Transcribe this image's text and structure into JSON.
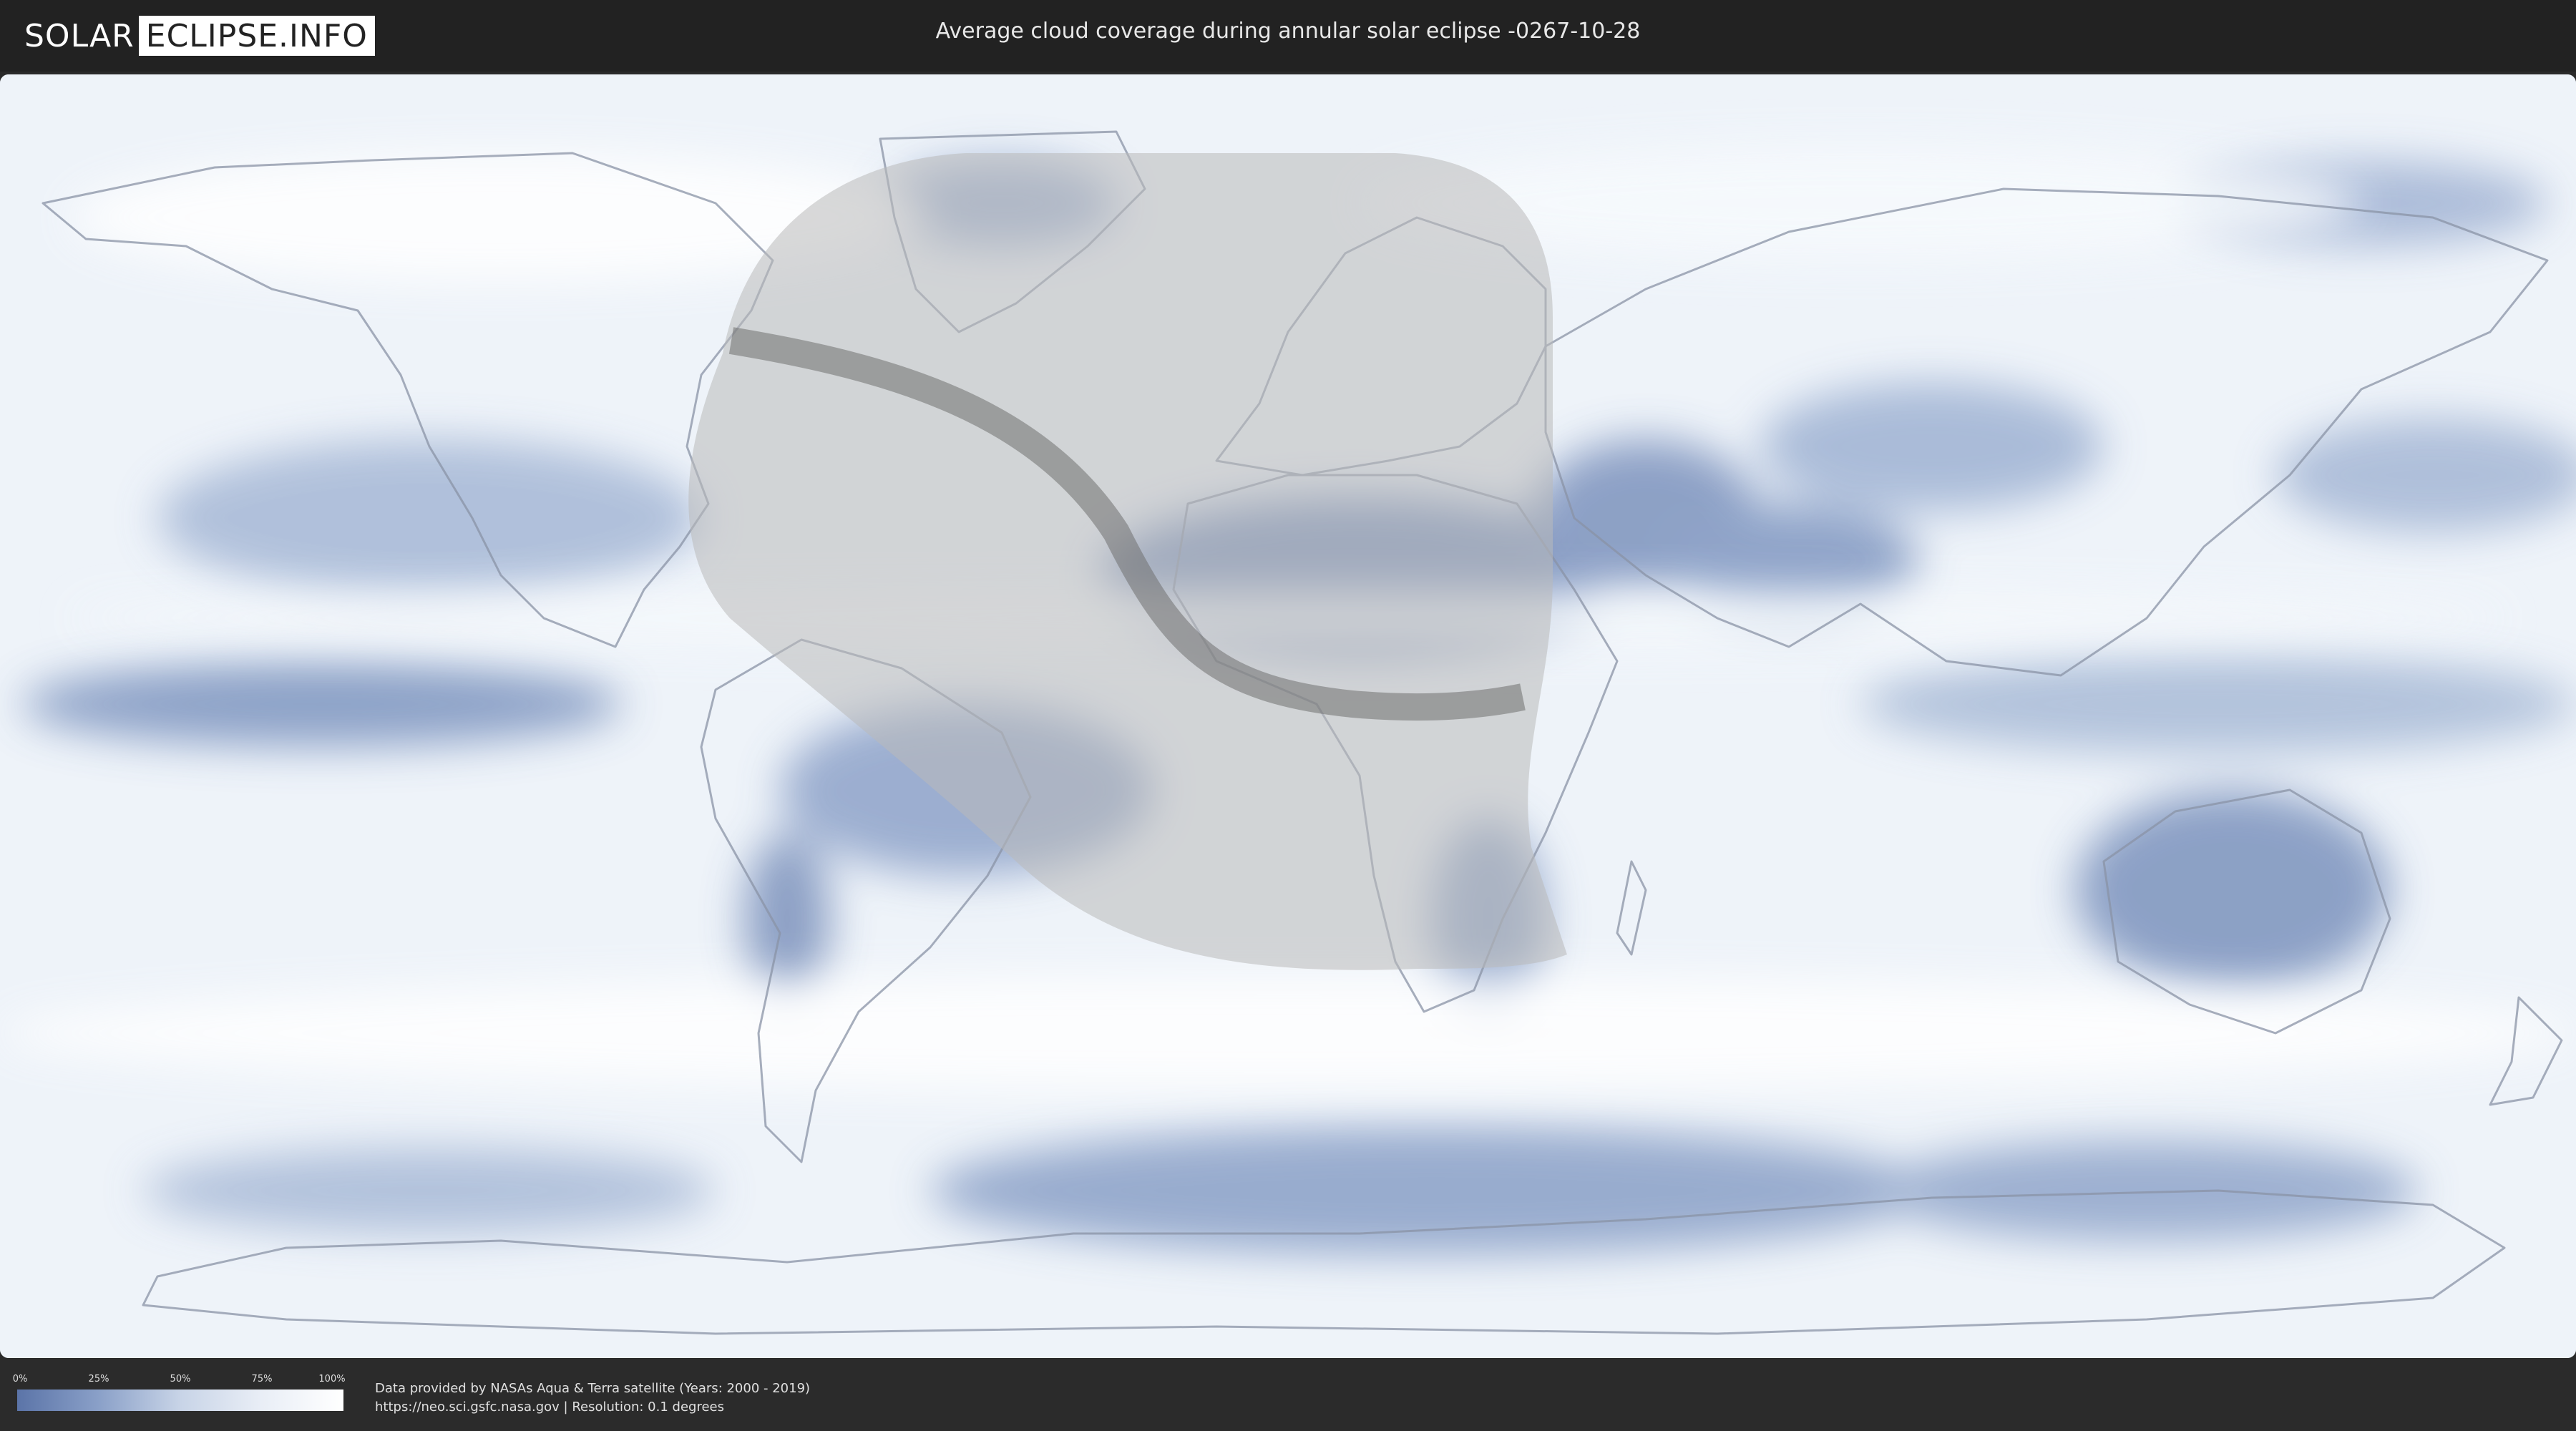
{
  "header": {
    "logo_solar": "SOLAR",
    "logo_eclipse": "ECLIPSE.INFO",
    "title": "Average cloud coverage during annular solar eclipse -0267-10-28"
  },
  "legend": {
    "ticks": [
      "0%",
      "25%",
      "50%",
      "75%",
      "100%"
    ],
    "colors": {
      "low": "#5b74a8",
      "high": "#ffffff"
    }
  },
  "credits": {
    "line1": "Data provided by NASAs Aqua & Terra satellite (Years: 2000 - 2019)",
    "line2": "https://neo.sci.gsfc.nasa.gov | Resolution: 0.1 degrees"
  },
  "map": {
    "projection": "equirectangular",
    "colors": {
      "cloud": "#f2f6fb",
      "clear": "#6f88b8",
      "eclipse_region": "#c8c8c8",
      "annular_path": "#777777"
    }
  }
}
